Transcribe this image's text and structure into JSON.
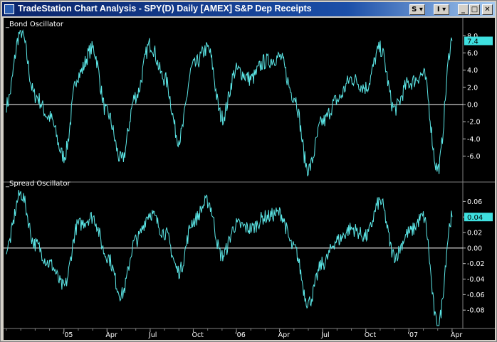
{
  "window": {
    "title": "TradeStation Chart Analysis - SPY(D)  Daily  [AMEX] S&P Dep Receipts",
    "buttons": {
      "symbol_menu": "S ▾",
      "interval_menu": "I ▾",
      "minimize": "_",
      "maximize": "□",
      "close": "✕"
    }
  },
  "colors": {
    "background": "#000000",
    "line": "#5ce8e8",
    "zero_line": "#ffffff",
    "label_bg": "#3fe0e0",
    "text": "#ffffff"
  },
  "chart_data": [
    {
      "type": "line",
      "title": "_Bond Oscillator",
      "x_range": [
        "2004-09",
        "2007-04"
      ],
      "ylim": [
        -8.6,
        8.6
      ],
      "y_ticks": [
        "8.0",
        "6.0",
        "4.0",
        "2.0",
        "0.0",
        "-2.0",
        "-4.0",
        "-6.0"
      ],
      "last_value_label": "7.4",
      "zero_line": true,
      "series": [
        {
          "x": [
            "2004-09",
            "2004-10",
            "2004-11",
            "2004-12",
            "2005-01",
            "2005-02",
            "2005-03",
            "2005-04",
            "2005-05",
            "2005-06",
            "2005-07",
            "2005-08",
            "2005-09",
            "2005-10",
            "2005-11",
            "2005-12",
            "2006-01",
            "2006-02",
            "2006-03",
            "2006-04",
            "2006-05",
            "2006-06",
            "2006-07",
            "2006-08",
            "2006-09",
            "2006-10",
            "2006-11",
            "2006-12",
            "2007-01",
            "2007-02",
            "2007-03",
            "2007-04"
          ],
          "y": [
            0,
            8.5,
            1.0,
            -1.5,
            -6.0,
            3.5,
            6.5,
            -1.0,
            -6.5,
            1.0,
            7.0,
            3.0,
            -4.0,
            4.5,
            6.5,
            -1.5,
            4.0,
            3.0,
            5.0,
            5.5,
            1.0,
            -7.5,
            -2.0,
            0.5,
            3.0,
            2.0,
            6.5,
            -0.5,
            2.5,
            3.5,
            -7.5,
            7.4
          ]
        }
      ]
    },
    {
      "type": "line",
      "title": "_Spread Oscillator",
      "x_range": [
        "2004-09",
        "2007-04"
      ],
      "ylim": [
        -0.1,
        0.075
      ],
      "y_ticks": [
        "0.06",
        "0.04",
        "0.02",
        "0.00",
        "-0.02",
        "-0.04",
        "-0.06",
        "-0.08"
      ],
      "last_value_label": "0.04",
      "zero_line": true,
      "x_ticks": [
        "'05",
        "Apr",
        "Jul",
        "Oct",
        "'06",
        "Apr",
        "Jul",
        "Oct",
        "'07",
        "Apr"
      ],
      "series": [
        {
          "x": [
            "2004-09",
            "2004-10",
            "2004-11",
            "2004-12",
            "2005-01",
            "2005-02",
            "2005-03",
            "2005-04",
            "2005-05",
            "2005-06",
            "2005-07",
            "2005-08",
            "2005-09",
            "2005-10",
            "2005-11",
            "2005-12",
            "2006-01",
            "2006-02",
            "2006-03",
            "2006-04",
            "2006-05",
            "2006-06",
            "2006-07",
            "2006-08",
            "2006-09",
            "2006-10",
            "2006-11",
            "2006-12",
            "2007-01",
            "2007-02",
            "2007-03",
            "2007-04"
          ],
          "y": [
            0,
            0.07,
            0.005,
            -0.02,
            -0.05,
            0.03,
            0.04,
            -0.01,
            -0.06,
            0.01,
            0.045,
            0.02,
            -0.03,
            0.035,
            0.06,
            -0.01,
            0.03,
            0.025,
            0.04,
            0.045,
            0.0,
            -0.07,
            -0.02,
            0.01,
            0.025,
            0.015,
            0.06,
            -0.01,
            0.02,
            0.04,
            -0.1,
            0.04
          ]
        }
      ]
    }
  ]
}
